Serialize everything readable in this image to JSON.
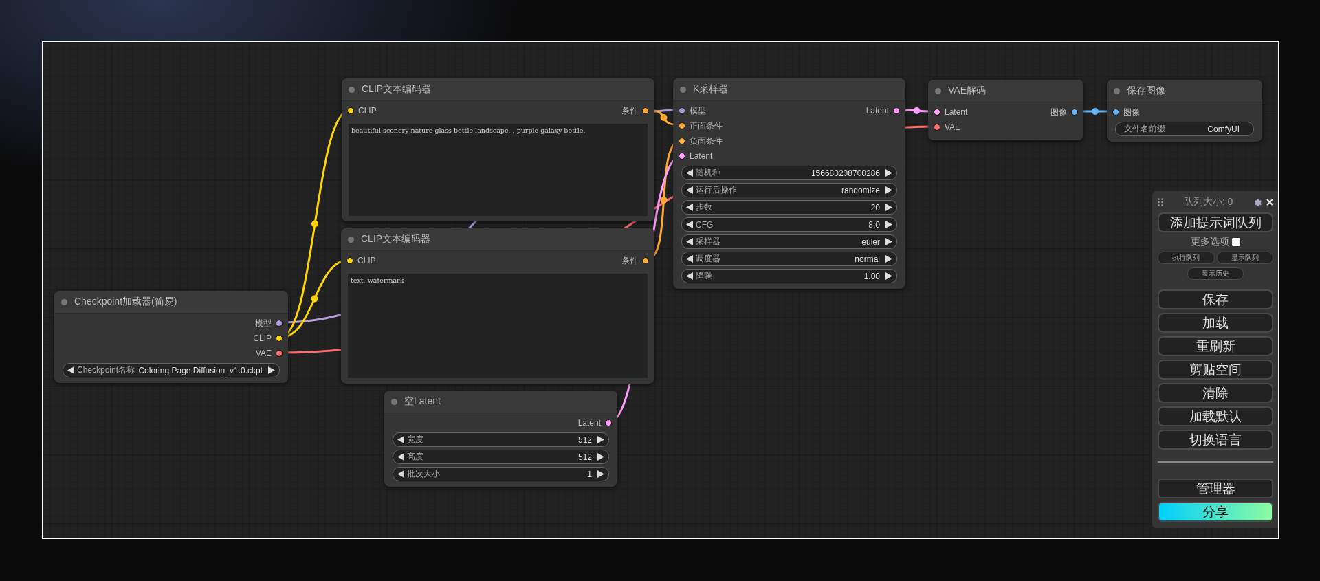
{
  "nodes": [
    {
      "kind": "clip_text",
      "title": "CLIP文本编码器",
      "inputs": [
        {
          "label": "CLIP",
          "color": "#ffd500"
        }
      ],
      "outputs": [
        {
          "label": "条件",
          "color": "#ffa931"
        }
      ],
      "text": "beautiful scenery nature glass bottle landscape, , purple galaxy bottle,"
    },
    {
      "kind": "sampler",
      "title": "K采样器",
      "inputs": [
        {
          "label": "模型",
          "color": "#b39ddb"
        },
        {
          "label": "正面条件",
          "color": "#ffa931"
        },
        {
          "label": "负面条件",
          "color": "#ffa931"
        },
        {
          "label": "Latent",
          "color": "#ff9cf9"
        }
      ],
      "outputs": [
        {
          "label": "Latent",
          "color": "#ff9cf9"
        }
      ],
      "widgets": [
        {
          "kind": "number",
          "label": "随机种",
          "value": "156680208700286"
        },
        {
          "kind": "combo",
          "label": "运行后操作",
          "value": "randomize"
        },
        {
          "kind": "number",
          "label": "步数",
          "value": "20"
        },
        {
          "kind": "number",
          "label": "CFG",
          "value": "8.0"
        },
        {
          "kind": "combo",
          "label": "采样器",
          "value": "euler"
        },
        {
          "kind": "combo",
          "label": "调度器",
          "value": "normal"
        },
        {
          "kind": "number",
          "label": "降噪",
          "value": "1.00"
        }
      ]
    },
    {
      "kind": "vae_decode",
      "title": "VAE解码",
      "inputs": [
        {
          "label": "Latent",
          "color": "#ff9cf9"
        },
        {
          "label": "VAE",
          "color": "#ff6e6e"
        }
      ],
      "outputs": [
        {
          "label": "图像",
          "color": "#64b5f6"
        }
      ]
    },
    {
      "kind": "save_image",
      "title": "保存图像",
      "inputs": [
        {
          "label": "图像",
          "color": "#64b5f6"
        }
      ],
      "widgets": [
        {
          "kind": "text",
          "label": "文件名前缀",
          "value": "ComfyUI"
        }
      ]
    },
    {
      "kind": "clip_text",
      "title": "CLIP文本编码器",
      "inputs": [
        {
          "label": "CLIP",
          "color": "#ffd500"
        }
      ],
      "outputs": [
        {
          "label": "条件",
          "color": "#ffa931"
        }
      ],
      "text": "text, watermark"
    },
    {
      "kind": "checkpoint",
      "title": "Checkpoint加载器(简易)",
      "outputs": [
        {
          "label": "模型",
          "color": "#b39ddb"
        },
        {
          "label": "CLIP",
          "color": "#ffd500"
        },
        {
          "label": "VAE",
          "color": "#ff6e6e"
        }
      ],
      "widgets": [
        {
          "kind": "combo",
          "label": "Checkpoint名称",
          "value": "Coloring Page Diffusion_v1.0.ckpt"
        }
      ]
    },
    {
      "kind": "empty_latent",
      "title": "空Latent",
      "outputs": [
        {
          "label": "Latent",
          "color": "#ff9cf9"
        }
      ],
      "widgets": [
        {
          "kind": "number",
          "label": "宽度",
          "value": "512"
        },
        {
          "kind": "number",
          "label": "高度",
          "value": "512"
        },
        {
          "kind": "number",
          "label": "批次大小",
          "value": "1"
        }
      ]
    }
  ],
  "queue_panel": {
    "title": "队列大小: 0",
    "main_button": "添加提示词队列",
    "more_options": {
      "label": "更多选项",
      "checked": false
    },
    "small_buttons": [
      "执行队列",
      "显示队列"
    ],
    "history_button": "显示历史",
    "buttons": [
      "保存",
      "加载",
      "重刷新",
      "剪贴空间",
      "清除",
      "加载默认",
      "切换语言"
    ],
    "bottom_buttons": [
      {
        "label": "管理器",
        "kind": "plain"
      },
      {
        "label": "分享",
        "kind": "gradient"
      }
    ]
  }
}
